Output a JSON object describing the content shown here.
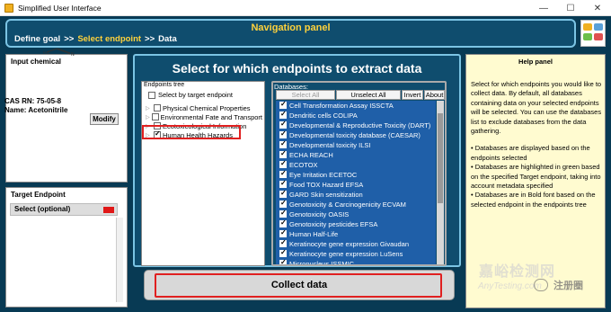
{
  "window": {
    "title": "Simplified User Interface",
    "minimize_glyph": "—",
    "maximize_glyph": "☐",
    "close_glyph": "✕"
  },
  "nav": {
    "title": "Navigation panel",
    "steps": [
      "Define goal",
      "Select endpoint",
      "Data"
    ],
    "separator": ">>",
    "active_step": "Select endpoint"
  },
  "input_chemical": {
    "header": "Input chemical",
    "cas_rn": "CAS RN: 75-05-8",
    "name": "Name: Acetonitrile",
    "modify_label": "Modify"
  },
  "target_endpoint": {
    "header": "Target Endpoint",
    "selected": "Select (optional)",
    "swatch_color": "#e01818"
  },
  "main": {
    "title": "Select for which endpoints to extract data",
    "endpoints_tree_label": "Endpoints tree",
    "select_by_target_label": "Select by target endpoint",
    "tree_items": [
      {
        "label": "Physical Chemical Properties",
        "checked": false
      },
      {
        "label": "Environmental Fate and Transport",
        "checked": false
      },
      {
        "label": "Ecotoxicological Information",
        "checked": false
      },
      {
        "label": "Human Health Hazards",
        "checked": true
      }
    ],
    "databases_label": "Databases:",
    "buttons": {
      "select_all": "Select All",
      "unselect_all": "Unselect All",
      "invert": "Invert",
      "about": "About"
    },
    "databases": [
      "Cell Transformation Assay ISSCTA",
      "Dendritic cells COLIPA",
      "Developmental & Reproductive Toxicity (DART)",
      "Developmental toxicity database (CAESAR)",
      "Developmental toxicity ILSI",
      "ECHA REACH",
      "ECOTOX",
      "Eye Irritation ECETOC",
      "Food TOX Hazard EFSA",
      "GARD Skin sensitization",
      "Genotoxicity & Carcinogenicity ECVAM",
      "Genotoxicity OASIS",
      "Genotoxicity pesticides EFSA",
      "Human Half-Life",
      "Keratinocyte gene expression Givaudan",
      "Keratinocyte gene expression LuSens",
      "Micronucleus ISSMIC"
    ],
    "collect_label": "Collect data",
    "list_color": "#1f5fa8",
    "highlight_color": "#e02020"
  },
  "help": {
    "title": "Help panel",
    "paragraphs": [
      "Select for which endpoints you would like to collect data. By default, all databases containing data on your selected endpoints will be selected. You can use the databases list to exclude databases from the data gathering.",
      "• Databases are displayed based on the endpoints selected",
      "• Databases are highlighted in green based on the specified Target endpoint, taking into account metadata specified",
      "• Databases are in Bold font based on the selected endpoint in the endpoints tree"
    ]
  },
  "watermark": {
    "line1": "嘉峪检测网",
    "line2": "AnyTesting.com",
    "line3": "注册圈"
  }
}
